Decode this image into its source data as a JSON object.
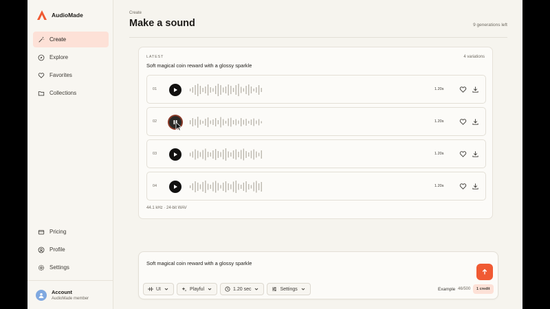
{
  "brand": {
    "name": "AudioMade",
    "accent": "#f05a33"
  },
  "sidebar": {
    "top_items": [
      {
        "label": "Create",
        "icon": "wand-icon",
        "active": true
      },
      {
        "label": "Explore",
        "icon": "compass-icon"
      },
      {
        "label": "Favorites",
        "icon": "heart-icon"
      },
      {
        "label": "Collections",
        "icon": "folder-icon"
      }
    ],
    "bottom_items": [
      {
        "label": "Pricing",
        "icon": "card-icon"
      },
      {
        "label": "Profile",
        "icon": "user-icon"
      },
      {
        "label": "Settings",
        "icon": "gear-icon"
      }
    ],
    "account": {
      "name": "Account",
      "subtitle": "AudioMade member"
    }
  },
  "header": {
    "breadcrumb": "Create",
    "title": "Make a sound",
    "generations_left": "9 generations left"
  },
  "results": {
    "section_label": "LATEST",
    "variations_count": "4 variations",
    "prompt": "Soft magical coin reward with a glossy sparkle",
    "rows": [
      {
        "number": "01",
        "duration": "1.20s",
        "state": "play"
      },
      {
        "number": "02",
        "duration": "1.20s",
        "state": "pause"
      },
      {
        "number": "03",
        "duration": "1.20s",
        "state": "play"
      },
      {
        "number": "04",
        "duration": "1.20s",
        "state": "play"
      }
    ],
    "format": "44.1 kHz · 24-bit WAV"
  },
  "composer": {
    "prompt_text": "Soft magical coin reward with a glossy sparkle",
    "chips": [
      {
        "label": "UI",
        "icon": "waveform-icon"
      },
      {
        "label": "Playful",
        "icon": "sparkle-icon"
      },
      {
        "label": "1.20 sec",
        "icon": "clock-icon"
      },
      {
        "label": "Settings",
        "icon": "sliders-icon"
      }
    ],
    "example_label": "Example",
    "char_count": "46/500",
    "credit_label": "1 credit"
  }
}
